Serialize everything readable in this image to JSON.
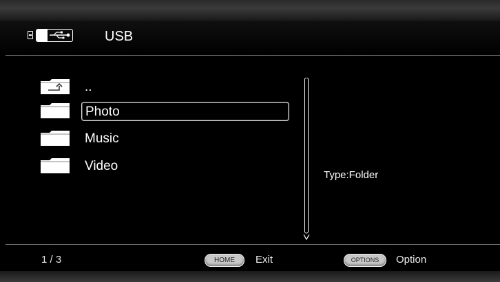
{
  "header": {
    "title": "USB",
    "device_icon": "usb-icon"
  },
  "file_list": {
    "items": [
      {
        "label": "..",
        "icon": "folder-up-icon",
        "selected": false
      },
      {
        "label": "Photo",
        "icon": "folder-icon",
        "selected": true
      },
      {
        "label": "Music",
        "icon": "folder-icon",
        "selected": false
      },
      {
        "label": "Video",
        "icon": "folder-icon",
        "selected": false
      }
    ]
  },
  "info_panel": {
    "type_text": "Type:Folder"
  },
  "footer": {
    "page_indicator": "1 / 3",
    "home_key": "HOME",
    "home_action": "Exit",
    "options_key": "OPTIONS",
    "options_action": "Option"
  },
  "colors": {
    "background": "#000000",
    "text": "#ffffff",
    "rule": "#6a6a6a",
    "key_pill": "#c8c8c8"
  }
}
